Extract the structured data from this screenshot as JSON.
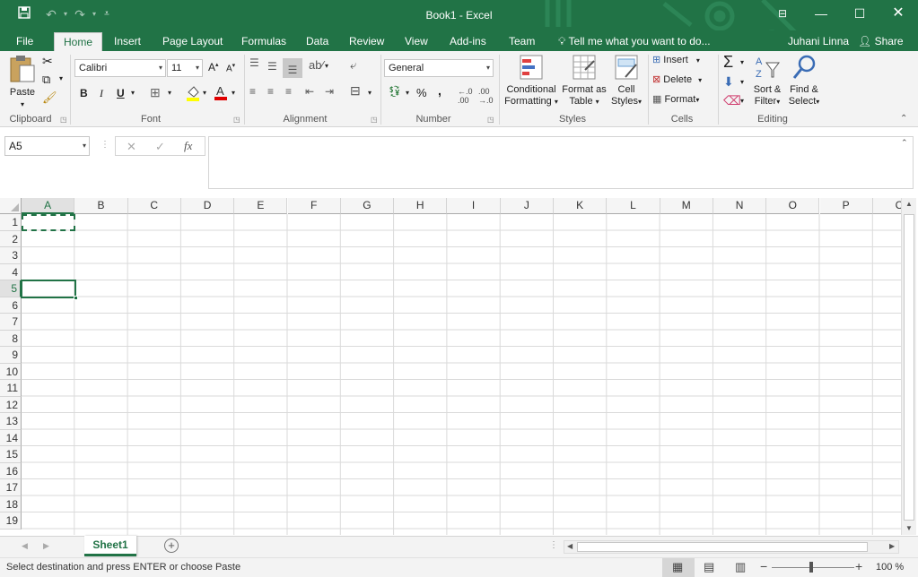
{
  "window": {
    "title": "Book1 - Excel",
    "user": "Juhani Linna",
    "share_label": "Share"
  },
  "tabs": [
    "File",
    "Home",
    "Insert",
    "Page Layout",
    "Formulas",
    "Data",
    "Review",
    "View",
    "Add-ins",
    "Team"
  ],
  "tell_me": "Tell me what you want to do...",
  "ribbon": {
    "clipboard": {
      "paste": "Paste",
      "label": "Clipboard"
    },
    "font": {
      "name": "Calibri",
      "size": "11",
      "bold": "B",
      "italic": "I",
      "underline": "U",
      "label": "Font"
    },
    "alignment": {
      "label": "Alignment"
    },
    "number": {
      "format": "General",
      "percent": "%",
      "comma": ",",
      "label": "Number"
    },
    "styles": {
      "cond1": "Conditional",
      "cond2": "Formatting",
      "fmt1": "Format as",
      "fmt2": "Table",
      "cell1": "Cell",
      "cell2": "Styles",
      "label": "Styles"
    },
    "cells": {
      "insert": "Insert",
      "delete": "Delete",
      "format": "Format",
      "label": "Cells"
    },
    "editing": {
      "sort1": "Sort &",
      "sort2": "Filter",
      "find1": "Find &",
      "find2": "Select",
      "label": "Editing"
    }
  },
  "formula_bar": {
    "name_box": "A5",
    "fx": "fx",
    "value": ""
  },
  "columns": [
    "A",
    "B",
    "C",
    "D",
    "E",
    "F",
    "G",
    "H",
    "I",
    "J",
    "K",
    "L",
    "M",
    "N",
    "O",
    "P",
    "C"
  ],
  "rows": [
    "1",
    "2",
    "3",
    "4",
    "5",
    "6",
    "7",
    "8",
    "9",
    "10",
    "11",
    "12",
    "13",
    "14",
    "15",
    "16",
    "17",
    "18",
    "19"
  ],
  "sheet": {
    "active_tab": "Sheet1"
  },
  "status": {
    "message": "Select destination and press ENTER or choose Paste",
    "zoom": "100 %"
  },
  "colors": {
    "brand": "#217346"
  }
}
